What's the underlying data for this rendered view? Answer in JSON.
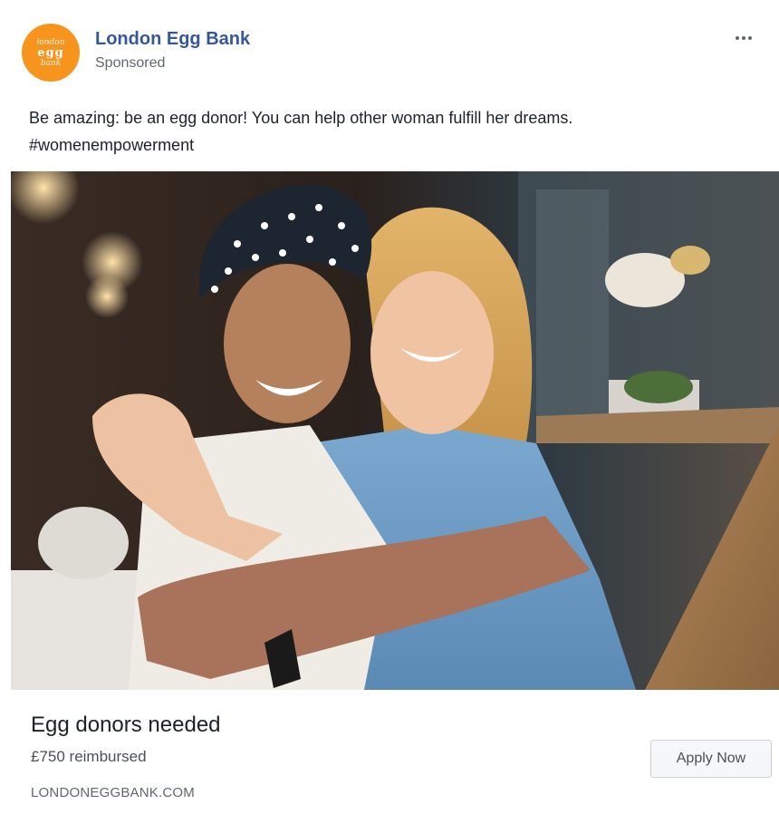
{
  "post": {
    "page_name": "London Egg Bank",
    "sponsored_label": "Sponsored",
    "avatar": {
      "line1": "london",
      "line2": "egg",
      "line3": "bank",
      "color": "#f7941d"
    },
    "more_icon": "more-horizontal-icon",
    "text_line1": "Be amazing: be an egg donor! You can help other woman fulfill her dreams.",
    "text_line2": "#womenempowerment"
  },
  "ad": {
    "headline": "Egg donors needed",
    "description": "£750 reimbursed",
    "domain": "LONDONEGGBANK.COM",
    "cta_label": "Apply Now"
  },
  "colors": {
    "page_name": "#365899",
    "secondary_text": "#616770",
    "cta_border": "#ccd0d5"
  }
}
